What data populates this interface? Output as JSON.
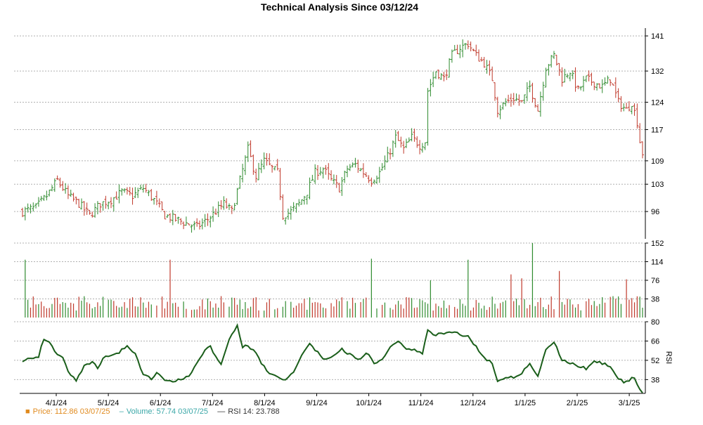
{
  "title": "Technical Analysis Since 03/12/24",
  "colors": {
    "up": "#2e8b2e",
    "down": "#c0392b",
    "rsi": "#1a5e1a",
    "grid": "#b0b0b0",
    "axis": "#000000"
  },
  "legend": {
    "price_marker": "■",
    "price_label": "Price: 112.86  03/07/25",
    "volume_marker": "–",
    "volume_label": "Volume: 57.74  03/07/25",
    "rsi_marker": "—",
    "rsi_label": "RSI 14: 23.788"
  },
  "chart_data": [
    {
      "type": "ohlc",
      "x_ticks": [
        "4/1/24",
        "5/1/24",
        "6/1/24",
        "7/1/24",
        "8/1/24",
        "9/1/24",
        "10/1/24",
        "11/1/24",
        "12/1/24",
        "1/1/25",
        "2/1/25",
        "3/1/25"
      ],
      "y_ticks": [
        96,
        103,
        109,
        117,
        124,
        132,
        141
      ],
      "ylim": [
        89,
        143
      ],
      "close_anchors": [
        [
          0,
          96
        ],
        [
          5,
          97
        ],
        [
          9,
          100
        ],
        [
          13,
          104
        ],
        [
          17,
          100
        ],
        [
          21,
          98
        ],
        [
          25,
          95
        ],
        [
          29,
          98
        ],
        [
          33,
          99
        ],
        [
          37,
          101
        ],
        [
          41,
          100
        ],
        [
          45,
          102
        ],
        [
          49,
          99
        ],
        [
          53,
          95
        ],
        [
          57,
          94
        ],
        [
          61,
          93
        ],
        [
          65,
          92
        ],
        [
          69,
          94
        ],
        [
          72,
          96
        ],
        [
          75,
          98
        ],
        [
          78,
          96
        ],
        [
          81,
          104
        ],
        [
          84,
          112
        ],
        [
          87,
          105
        ],
        [
          90,
          109
        ],
        [
          93,
          107
        ],
        [
          95,
          106
        ],
        [
          97,
          95
        ],
        [
          100,
          96
        ],
        [
          103,
          98
        ],
        [
          106,
          101
        ],
        [
          109,
          106
        ],
        [
          112,
          107
        ],
        [
          115,
          104
        ],
        [
          118,
          102
        ],
        [
          121,
          107
        ],
        [
          124,
          108
        ],
        [
          127,
          106
        ],
        [
          130,
          104
        ],
        [
          133,
          106
        ],
        [
          136,
          110
        ],
        [
          139,
          115
        ],
        [
          142,
          112
        ],
        [
          145,
          115
        ],
        [
          148,
          113
        ],
        [
          150,
          114
        ],
        [
          151,
          127
        ],
        [
          154,
          132
        ],
        [
          157,
          130
        ],
        [
          160,
          136
        ],
        [
          163,
          138
        ],
        [
          166,
          139
        ],
        [
          169,
          136
        ],
        [
          172,
          134
        ],
        [
          175,
          130
        ],
        [
          177,
          122
        ],
        [
          180,
          124
        ],
        [
          183,
          125
        ],
        [
          186,
          124
        ],
        [
          189,
          128
        ],
        [
          192,
          122
        ],
        [
          195,
          133
        ],
        [
          198,
          136
        ],
        [
          201,
          130
        ],
        [
          204,
          132
        ],
        [
          207,
          127
        ],
        [
          210,
          130
        ],
        [
          213,
          129
        ],
        [
          216,
          128
        ],
        [
          219,
          130
        ],
        [
          222,
          124
        ],
        [
          225,
          122
        ],
        [
          227,
          124
        ],
        [
          229,
          119
        ],
        [
          230,
          114
        ],
        [
          231,
          111
        ]
      ],
      "n_bars": 232
    },
    {
      "type": "bar",
      "y_ticks": [
        38,
        76,
        114,
        152
      ],
      "ylim": [
        0,
        152
      ],
      "spikes": [
        [
          1,
          118
        ],
        [
          55,
          118
        ],
        [
          130,
          120
        ],
        [
          166,
          118
        ],
        [
          190,
          152
        ],
        [
          200,
          95
        ],
        [
          182,
          88
        ],
        [
          152,
          76
        ],
        [
          186,
          80
        ],
        [
          225,
          78
        ]
      ]
    },
    {
      "type": "line",
      "ylabel": "RSI",
      "y_ticks": [
        38,
        52,
        66,
        80
      ],
      "ylim": [
        28,
        80
      ],
      "anchors": [
        [
          0,
          52
        ],
        [
          3,
          54
        ],
        [
          6,
          55
        ],
        [
          8,
          68
        ],
        [
          10,
          66
        ],
        [
          12,
          58
        ],
        [
          15,
          55
        ],
        [
          17,
          44
        ],
        [
          20,
          38
        ],
        [
          23,
          48
        ],
        [
          26,
          51
        ],
        [
          28,
          46
        ],
        [
          30,
          54
        ],
        [
          33,
          56
        ],
        [
          36,
          58
        ],
        [
          39,
          63
        ],
        [
          42,
          56
        ],
        [
          45,
          42
        ],
        [
          48,
          38
        ],
        [
          50,
          44
        ],
        [
          53,
          38
        ],
        [
          56,
          37
        ],
        [
          59,
          38
        ],
        [
          62,
          40
        ],
        [
          65,
          50
        ],
        [
          68,
          60
        ],
        [
          70,
          62
        ],
        [
          72,
          54
        ],
        [
          74,
          50
        ],
        [
          77,
          68
        ],
        [
          80,
          77
        ],
        [
          82,
          62
        ],
        [
          84,
          62
        ],
        [
          86,
          60
        ],
        [
          89,
          50
        ],
        [
          92,
          42
        ],
        [
          95,
          40
        ],
        [
          98,
          38
        ],
        [
          101,
          44
        ],
        [
          104,
          56
        ],
        [
          107,
          64
        ],
        [
          110,
          58
        ],
        [
          113,
          52
        ],
        [
          116,
          56
        ],
        [
          119,
          60
        ],
        [
          122,
          56
        ],
        [
          125,
          52
        ],
        [
          128,
          58
        ],
        [
          131,
          50
        ],
        [
          134,
          52
        ],
        [
          137,
          62
        ],
        [
          140,
          66
        ],
        [
          143,
          60
        ],
        [
          146,
          60
        ],
        [
          149,
          56
        ],
        [
          151,
          74
        ],
        [
          154,
          70
        ],
        [
          157,
          72
        ],
        [
          160,
          72
        ],
        [
          163,
          71
        ],
        [
          166,
          69
        ],
        [
          169,
          62
        ],
        [
          172,
          54
        ],
        [
          175,
          50
        ],
        [
          177,
          37
        ],
        [
          180,
          40
        ],
        [
          183,
          40
        ],
        [
          186,
          43
        ],
        [
          189,
          50
        ],
        [
          192,
          40
        ],
        [
          195,
          60
        ],
        [
          198,
          66
        ],
        [
          201,
          52
        ],
        [
          204,
          50
        ],
        [
          207,
          48
        ],
        [
          210,
          46
        ],
        [
          213,
          52
        ],
        [
          216,
          50
        ],
        [
          219,
          48
        ],
        [
          222,
          38
        ],
        [
          225,
          36
        ],
        [
          228,
          40
        ],
        [
          230,
          30
        ],
        [
          231,
          28
        ]
      ]
    }
  ]
}
